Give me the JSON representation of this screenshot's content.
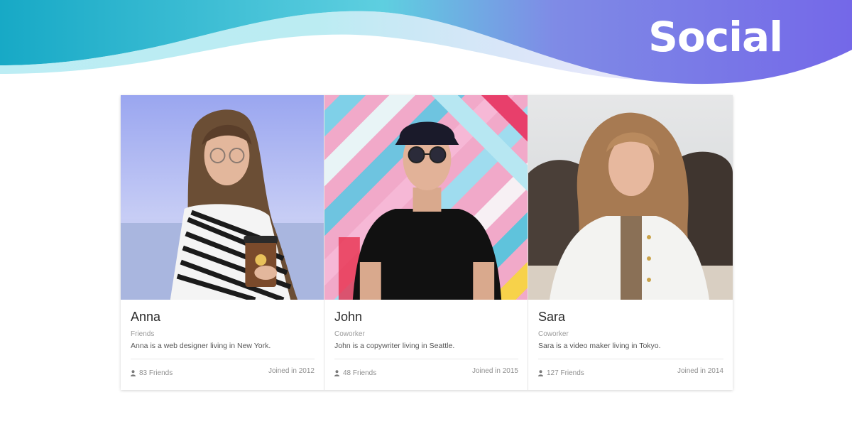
{
  "header": {
    "title": "Social"
  },
  "colors": {
    "wave_left": "#1fb3c8",
    "wave_mid": "#6ad6e4",
    "wave_right": "#7a6de8",
    "white": "#ffffff"
  },
  "cards": [
    {
      "name": "Anna",
      "relation": "Friends",
      "description": "Anna is a web designer living in New York.",
      "friends": "83 Friends",
      "joined": "Joined in 2012"
    },
    {
      "name": "John",
      "relation": "Coworker",
      "description": "John is a copywriter living in Seattle.",
      "friends": "48 Friends",
      "joined": "Joined in 2015"
    },
    {
      "name": "Sara",
      "relation": "Coworker",
      "description": "Sara is a video maker living in Tokyo.",
      "friends": "127 Friends",
      "joined": "Joined in 2014"
    }
  ],
  "icons": {
    "friends": "user-icon"
  }
}
